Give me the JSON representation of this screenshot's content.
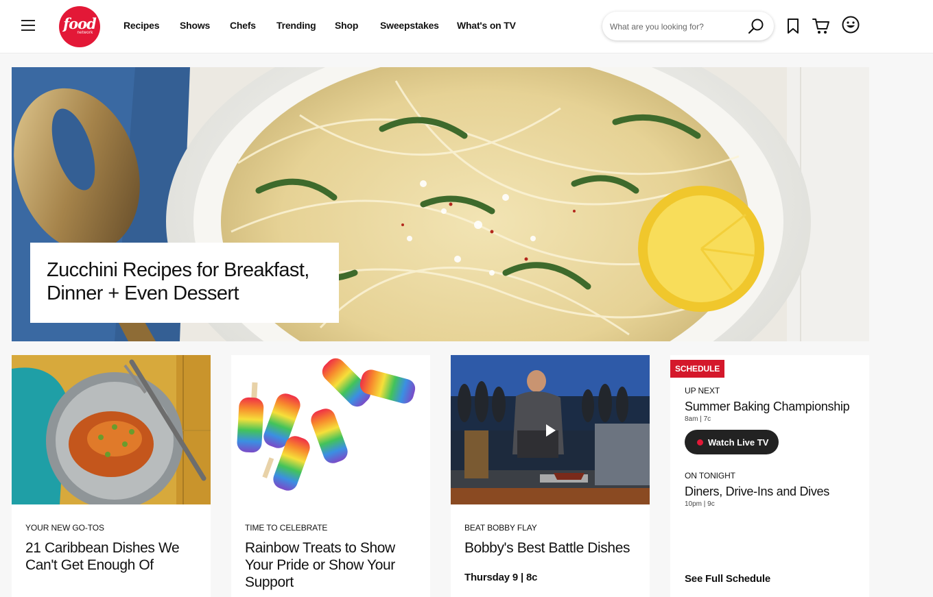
{
  "header": {
    "logo_text": "food",
    "logo_subtext": "network",
    "nav": [
      "Recipes",
      "Shows",
      "Chefs",
      "Trending",
      "Shop",
      "Sweepstakes",
      "What's on TV"
    ],
    "search_placeholder": "What are you looking for?"
  },
  "hero": {
    "title": "Zucchini Recipes for Breakfast, Dinner + Even Dessert"
  },
  "cards": [
    {
      "eyebrow": "YOUR NEW GO-TOS",
      "title": "21 Caribbean Dishes We Can't Get Enough Of"
    },
    {
      "eyebrow": "TIME TO CELEBRATE",
      "title": "Rainbow Treats to Show Your Pride or Show Your Support"
    },
    {
      "eyebrow": "BEAT BOBBY FLAY",
      "title": "Bobby's Best Battle Dishes",
      "time": "Thursday 9 | 8c"
    }
  ],
  "schedule": {
    "badge": "SCHEDULE",
    "up_next_label": "UP NEXT",
    "up_next_show": "Summer Baking Championship",
    "up_next_time": "8am | 7c",
    "watch_label": "Watch Live TV",
    "tonight_label": "ON TONIGHT",
    "tonight_show": "Diners, Drive-Ins and Dives",
    "tonight_time": "10pm | 9c",
    "see_full": "See Full Schedule"
  },
  "colors": {
    "brand_red": "#e31837",
    "schedule_red": "#d4182b",
    "button_dark": "#222222"
  },
  "icons": [
    "menu-icon",
    "search-icon",
    "bookmark-icon",
    "cart-icon",
    "smiley-icon",
    "play-icon"
  ]
}
